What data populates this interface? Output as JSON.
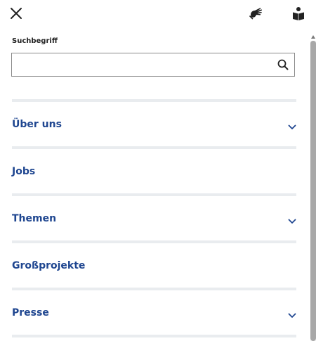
{
  "header": {
    "close_icon": "close-icon",
    "sign_language_icon": "sign-language-icon",
    "easy_language_icon": "easy-language-icon"
  },
  "search": {
    "label": "Suchbegriff",
    "value": "",
    "placeholder": "",
    "icon": "search-icon"
  },
  "nav": {
    "items": [
      {
        "label": "Über uns",
        "expandable": true
      },
      {
        "label": "Jobs",
        "expandable": false
      },
      {
        "label": "Themen",
        "expandable": true
      },
      {
        "label": "Großprojekte",
        "expandable": false
      },
      {
        "label": "Presse",
        "expandable": true
      }
    ]
  },
  "colors": {
    "link": "#1f4690",
    "separator": "#e9ecef",
    "icon": "#222222"
  }
}
